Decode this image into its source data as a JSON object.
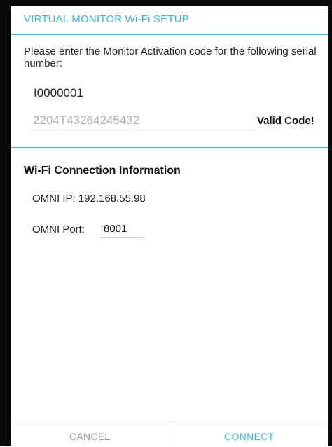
{
  "dialog": {
    "title": "VIRTUAL MONITOR Wi-Fi SETUP",
    "prompt": "Please enter the Monitor Activation code for the following serial number:",
    "serial_number": "I0000001",
    "activation_code": "2204T43264245432",
    "validation_status": "Valid Code!",
    "wifi_section": {
      "heading": "Wi-Fi Connection Information",
      "omni_ip": "OMNI IP: 192.168.55.98",
      "omni_port_label": "OMNI Port:",
      "omni_port_value": "8001"
    },
    "buttons": {
      "cancel": "CANCEL",
      "connect": "CONNECT"
    }
  },
  "colors": {
    "accent": "#33b5e5",
    "text": "#222222",
    "muted": "#9a9a9a"
  }
}
